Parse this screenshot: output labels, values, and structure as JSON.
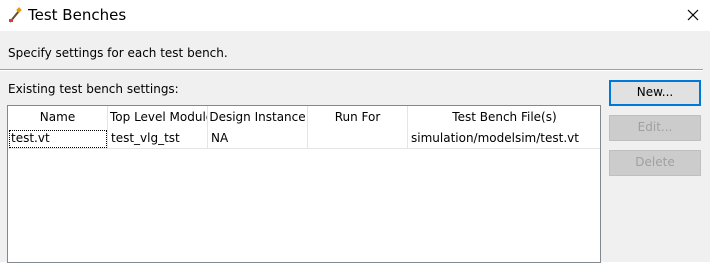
{
  "window": {
    "title": "Test Benches",
    "icon": "wand-icon",
    "close_icon": "close-icon"
  },
  "description": "Specify settings for each test bench.",
  "section_label": "Existing test bench settings:",
  "table": {
    "columns": [
      "Name",
      "Top Level Module",
      "Design Instance",
      "Run For",
      "Test Bench File(s)"
    ],
    "rows": [
      {
        "name": "test.vt",
        "top_level_module": "test_vlg_tst",
        "design_instance": "NA",
        "run_for": "",
        "files": "simulation/modelsim/test.vt"
      }
    ]
  },
  "buttons": {
    "new": "New...",
    "edit": "Edit...",
    "delete": "Delete"
  }
}
